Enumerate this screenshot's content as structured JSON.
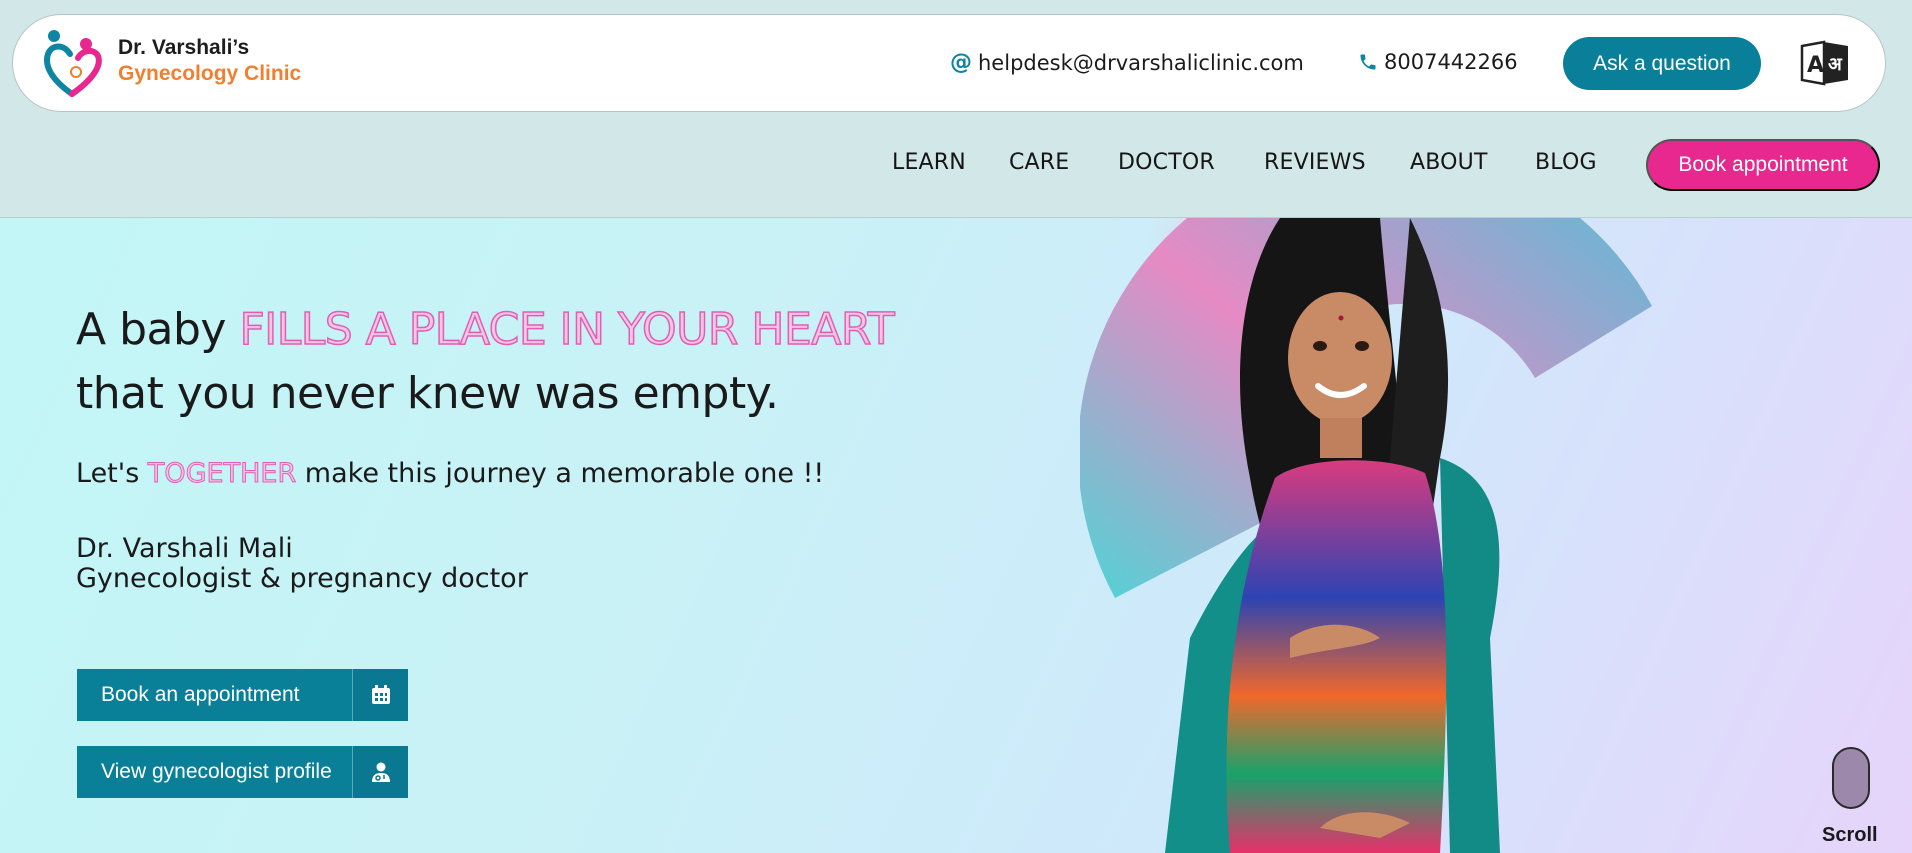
{
  "header": {
    "brand_line1": "Dr. Varshali’s",
    "brand_line2": "Gynecology Clinic",
    "email": "helpdesk@drvarshaliclinic.com",
    "phone": "8007442266",
    "ask_button": "Ask a question",
    "language_icon": "translate-icon"
  },
  "nav": {
    "items": [
      "LEARN",
      "CARE",
      "DOCTOR",
      "REVIEWS",
      "ABOUT",
      "BLOG"
    ],
    "book_button": "Book appointment"
  },
  "hero": {
    "headline_pre": "A baby",
    "headline_highlight": "FILLS A PLACE IN YOUR HEART",
    "headline_line2": "that you never knew was empty.",
    "sub_pre": "Let's",
    "sub_highlight": "TOGETHER",
    "sub_post": "make this journey a memorable one !!",
    "doctor_name": "Dr. Varshali Mali",
    "doctor_title": "Gynecologist & pregnancy doctor",
    "btn_appointment": "Book an appointment",
    "btn_profile": "View gynecologist profile",
    "scroll_label": "Scroll"
  },
  "colors": {
    "teal": "#0a7f99",
    "pink": "#e8288f",
    "orange": "#f07f2e"
  }
}
